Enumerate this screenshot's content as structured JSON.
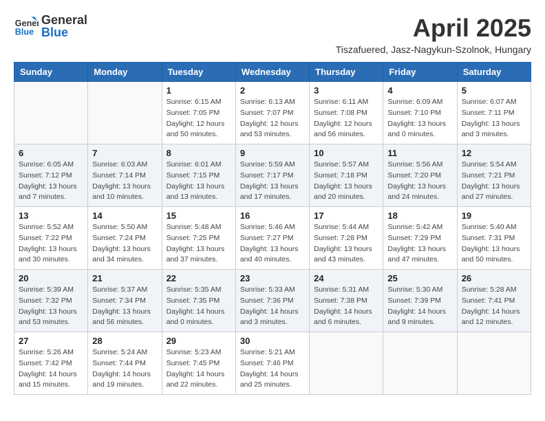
{
  "logo": {
    "general": "General",
    "blue": "Blue"
  },
  "title": "April 2025",
  "location": "Tiszafuered, Jasz-Nagykun-Szolnok, Hungary",
  "headers": [
    "Sunday",
    "Monday",
    "Tuesday",
    "Wednesday",
    "Thursday",
    "Friday",
    "Saturday"
  ],
  "weeks": [
    [
      {
        "day": "",
        "info": ""
      },
      {
        "day": "",
        "info": ""
      },
      {
        "day": "1",
        "info": "Sunrise: 6:15 AM\nSunset: 7:05 PM\nDaylight: 12 hours\nand 50 minutes."
      },
      {
        "day": "2",
        "info": "Sunrise: 6:13 AM\nSunset: 7:07 PM\nDaylight: 12 hours\nand 53 minutes."
      },
      {
        "day": "3",
        "info": "Sunrise: 6:11 AM\nSunset: 7:08 PM\nDaylight: 12 hours\nand 56 minutes."
      },
      {
        "day": "4",
        "info": "Sunrise: 6:09 AM\nSunset: 7:10 PM\nDaylight: 13 hours\nand 0 minutes."
      },
      {
        "day": "5",
        "info": "Sunrise: 6:07 AM\nSunset: 7:11 PM\nDaylight: 13 hours\nand 3 minutes."
      }
    ],
    [
      {
        "day": "6",
        "info": "Sunrise: 6:05 AM\nSunset: 7:12 PM\nDaylight: 13 hours\nand 7 minutes."
      },
      {
        "day": "7",
        "info": "Sunrise: 6:03 AM\nSunset: 7:14 PM\nDaylight: 13 hours\nand 10 minutes."
      },
      {
        "day": "8",
        "info": "Sunrise: 6:01 AM\nSunset: 7:15 PM\nDaylight: 13 hours\nand 13 minutes."
      },
      {
        "day": "9",
        "info": "Sunrise: 5:59 AM\nSunset: 7:17 PM\nDaylight: 13 hours\nand 17 minutes."
      },
      {
        "day": "10",
        "info": "Sunrise: 5:57 AM\nSunset: 7:18 PM\nDaylight: 13 hours\nand 20 minutes."
      },
      {
        "day": "11",
        "info": "Sunrise: 5:56 AM\nSunset: 7:20 PM\nDaylight: 13 hours\nand 24 minutes."
      },
      {
        "day": "12",
        "info": "Sunrise: 5:54 AM\nSunset: 7:21 PM\nDaylight: 13 hours\nand 27 minutes."
      }
    ],
    [
      {
        "day": "13",
        "info": "Sunrise: 5:52 AM\nSunset: 7:22 PM\nDaylight: 13 hours\nand 30 minutes."
      },
      {
        "day": "14",
        "info": "Sunrise: 5:50 AM\nSunset: 7:24 PM\nDaylight: 13 hours\nand 34 minutes."
      },
      {
        "day": "15",
        "info": "Sunrise: 5:48 AM\nSunset: 7:25 PM\nDaylight: 13 hours\nand 37 minutes."
      },
      {
        "day": "16",
        "info": "Sunrise: 5:46 AM\nSunset: 7:27 PM\nDaylight: 13 hours\nand 40 minutes."
      },
      {
        "day": "17",
        "info": "Sunrise: 5:44 AM\nSunset: 7:28 PM\nDaylight: 13 hours\nand 43 minutes."
      },
      {
        "day": "18",
        "info": "Sunrise: 5:42 AM\nSunset: 7:29 PM\nDaylight: 13 hours\nand 47 minutes."
      },
      {
        "day": "19",
        "info": "Sunrise: 5:40 AM\nSunset: 7:31 PM\nDaylight: 13 hours\nand 50 minutes."
      }
    ],
    [
      {
        "day": "20",
        "info": "Sunrise: 5:39 AM\nSunset: 7:32 PM\nDaylight: 13 hours\nand 53 minutes."
      },
      {
        "day": "21",
        "info": "Sunrise: 5:37 AM\nSunset: 7:34 PM\nDaylight: 13 hours\nand 56 minutes."
      },
      {
        "day": "22",
        "info": "Sunrise: 5:35 AM\nSunset: 7:35 PM\nDaylight: 14 hours\nand 0 minutes."
      },
      {
        "day": "23",
        "info": "Sunrise: 5:33 AM\nSunset: 7:36 PM\nDaylight: 14 hours\nand 3 minutes."
      },
      {
        "day": "24",
        "info": "Sunrise: 5:31 AM\nSunset: 7:38 PM\nDaylight: 14 hours\nand 6 minutes."
      },
      {
        "day": "25",
        "info": "Sunrise: 5:30 AM\nSunset: 7:39 PM\nDaylight: 14 hours\nand 9 minutes."
      },
      {
        "day": "26",
        "info": "Sunrise: 5:28 AM\nSunset: 7:41 PM\nDaylight: 14 hours\nand 12 minutes."
      }
    ],
    [
      {
        "day": "27",
        "info": "Sunrise: 5:26 AM\nSunset: 7:42 PM\nDaylight: 14 hours\nand 15 minutes."
      },
      {
        "day": "28",
        "info": "Sunrise: 5:24 AM\nSunset: 7:44 PM\nDaylight: 14 hours\nand 19 minutes."
      },
      {
        "day": "29",
        "info": "Sunrise: 5:23 AM\nSunset: 7:45 PM\nDaylight: 14 hours\nand 22 minutes."
      },
      {
        "day": "30",
        "info": "Sunrise: 5:21 AM\nSunset: 7:46 PM\nDaylight: 14 hours\nand 25 minutes."
      },
      {
        "day": "",
        "info": ""
      },
      {
        "day": "",
        "info": ""
      },
      {
        "day": "",
        "info": ""
      }
    ]
  ]
}
